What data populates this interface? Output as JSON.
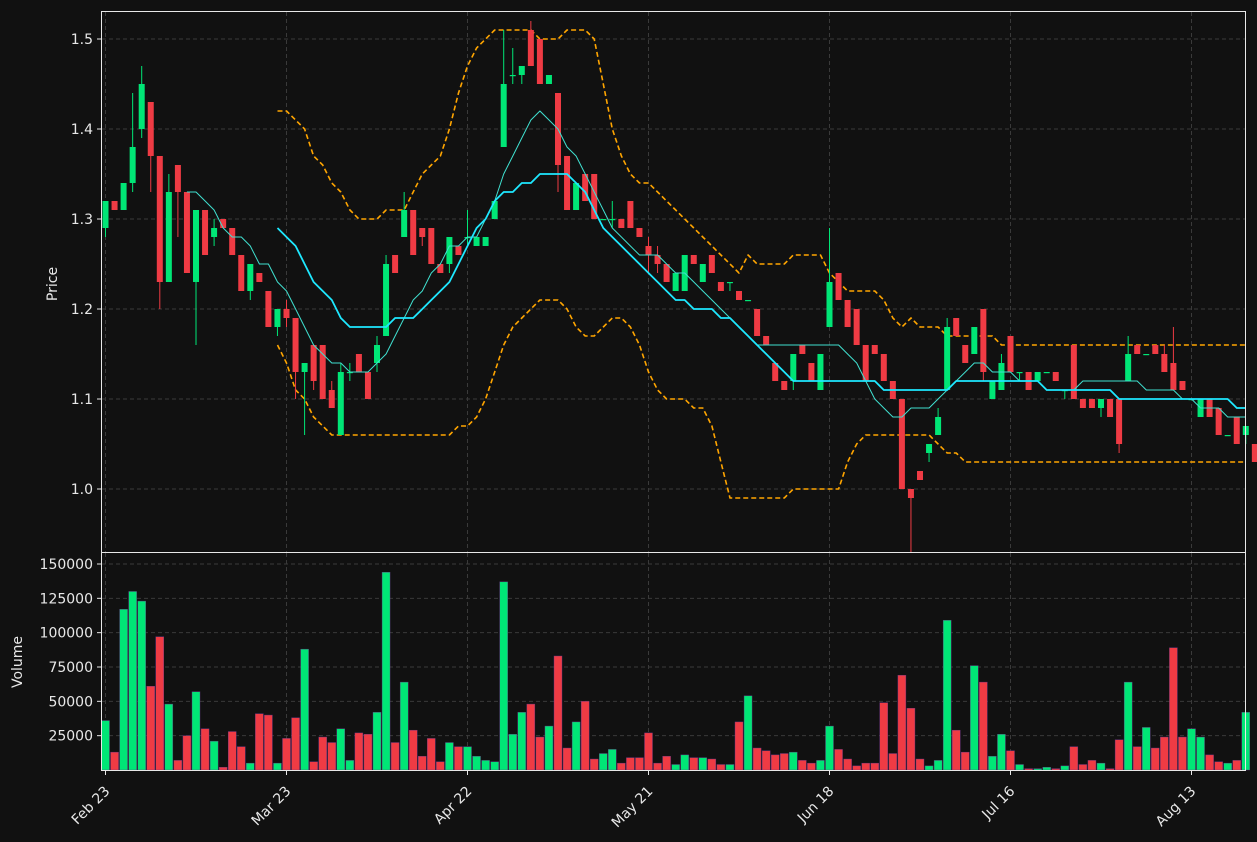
{
  "chart_data": {
    "type": "candlestick",
    "panels": [
      {
        "name": "price",
        "ylabel": "Price",
        "yticks": [
          1.0,
          1.1,
          1.2,
          1.3,
          1.4,
          1.5
        ],
        "ylim": [
          0.93,
          1.53
        ]
      },
      {
        "name": "volume",
        "ylabel": "Volume",
        "yticks": [
          25000,
          50000,
          75000,
          100000,
          125000,
          150000
        ],
        "ylim": [
          0,
          158000
        ]
      }
    ],
    "xticks": [
      {
        "label": "Feb 23",
        "index": 0
      },
      {
        "label": "Mar 23",
        "index": 20
      },
      {
        "label": "Apr 22",
        "index": 40
      },
      {
        "label": "May 21",
        "index": 60
      },
      {
        "label": "Jun 18",
        "index": 80
      },
      {
        "label": "Jul 16",
        "index": 100
      },
      {
        "label": "Aug 13",
        "index": 120
      }
    ],
    "up_color": "#00e676",
    "down_color": "#ef3b44",
    "colors": {
      "ma_fast": "#40e0d0",
      "ma_slow": "#1ee8ff",
      "bands": "#ffa500",
      "grid": "#3a3a3a"
    },
    "ohlc": [
      [
        1.29,
        1.32,
        1.28,
        1.32
      ],
      [
        1.32,
        1.32,
        1.31,
        1.31
      ],
      [
        1.31,
        1.34,
        1.31,
        1.34
      ],
      [
        1.34,
        1.44,
        1.33,
        1.38
      ],
      [
        1.4,
        1.47,
        1.39,
        1.45
      ],
      [
        1.43,
        1.43,
        1.33,
        1.37
      ],
      [
        1.37,
        1.37,
        1.2,
        1.23
      ],
      [
        1.23,
        1.35,
        1.23,
        1.33
      ],
      [
        1.36,
        1.36,
        1.28,
        1.33
      ],
      [
        1.33,
        1.33,
        1.24,
        1.24
      ],
      [
        1.23,
        1.31,
        1.16,
        1.31
      ],
      [
        1.31,
        1.31,
        1.26,
        1.26
      ],
      [
        1.28,
        1.3,
        1.27,
        1.29
      ],
      [
        1.3,
        1.3,
        1.29,
        1.29
      ],
      [
        1.29,
        1.29,
        1.26,
        1.26
      ],
      [
        1.26,
        1.26,
        1.22,
        1.22
      ],
      [
        1.22,
        1.25,
        1.21,
        1.25
      ],
      [
        1.24,
        1.24,
        1.23,
        1.23
      ],
      [
        1.22,
        1.22,
        1.18,
        1.18
      ],
      [
        1.18,
        1.2,
        1.17,
        1.2
      ],
      [
        1.2,
        1.21,
        1.18,
        1.19
      ],
      [
        1.19,
        1.19,
        1.1,
        1.13
      ],
      [
        1.13,
        1.14,
        1.06,
        1.14
      ],
      [
        1.16,
        1.16,
        1.11,
        1.12
      ],
      [
        1.16,
        1.16,
        1.1,
        1.1
      ],
      [
        1.11,
        1.12,
        1.09,
        1.09
      ],
      [
        1.06,
        1.14,
        1.06,
        1.13
      ],
      [
        1.13,
        1.14,
        1.12,
        1.13
      ],
      [
        1.15,
        1.15,
        1.13,
        1.13
      ],
      [
        1.13,
        1.13,
        1.1,
        1.1
      ],
      [
        1.14,
        1.17,
        1.13,
        1.16
      ],
      [
        1.17,
        1.26,
        1.17,
        1.25
      ],
      [
        1.26,
        1.26,
        1.24,
        1.24
      ],
      [
        1.28,
        1.33,
        1.28,
        1.31
      ],
      [
        1.31,
        1.31,
        1.26,
        1.26
      ],
      [
        1.29,
        1.29,
        1.27,
        1.28
      ],
      [
        1.29,
        1.29,
        1.25,
        1.25
      ],
      [
        1.25,
        1.25,
        1.24,
        1.24
      ],
      [
        1.25,
        1.28,
        1.24,
        1.28
      ],
      [
        1.27,
        1.27,
        1.26,
        1.26
      ],
      [
        1.28,
        1.31,
        1.27,
        1.28
      ],
      [
        1.27,
        1.28,
        1.27,
        1.28
      ],
      [
        1.27,
        1.28,
        1.27,
        1.28
      ],
      [
        1.3,
        1.32,
        1.3,
        1.32
      ],
      [
        1.38,
        1.51,
        1.38,
        1.45
      ],
      [
        1.46,
        1.49,
        1.45,
        1.46
      ],
      [
        1.46,
        1.47,
        1.45,
        1.47
      ],
      [
        1.51,
        1.52,
        1.47,
        1.47
      ],
      [
        1.5,
        1.5,
        1.45,
        1.45
      ],
      [
        1.45,
        1.46,
        1.45,
        1.46
      ],
      [
        1.44,
        1.44,
        1.33,
        1.36
      ],
      [
        1.37,
        1.37,
        1.31,
        1.31
      ],
      [
        1.31,
        1.34,
        1.31,
        1.34
      ],
      [
        1.35,
        1.35,
        1.32,
        1.32
      ],
      [
        1.35,
        1.35,
        1.3,
        1.3
      ],
      [
        1.3,
        1.3,
        1.3,
        1.3
      ],
      [
        1.3,
        1.32,
        1.29,
        1.3
      ],
      [
        1.3,
        1.3,
        1.29,
        1.29
      ],
      [
        1.32,
        1.32,
        1.29,
        1.29
      ],
      [
        1.29,
        1.29,
        1.28,
        1.28
      ],
      [
        1.27,
        1.28,
        1.24,
        1.26
      ],
      [
        1.26,
        1.27,
        1.24,
        1.25
      ],
      [
        1.25,
        1.25,
        1.23,
        1.23
      ],
      [
        1.22,
        1.24,
        1.22,
        1.24
      ],
      [
        1.22,
        1.25,
        1.22,
        1.26
      ],
      [
        1.26,
        1.26,
        1.25,
        1.25
      ],
      [
        1.23,
        1.25,
        1.23,
        1.25
      ],
      [
        1.26,
        1.26,
        1.25,
        1.24
      ],
      [
        1.23,
        1.23,
        1.22,
        1.22
      ],
      [
        1.23,
        1.23,
        1.22,
        1.23
      ],
      [
        1.22,
        1.22,
        1.21,
        1.21
      ],
      [
        1.21,
        1.21,
        1.21,
        1.21
      ],
      [
        1.2,
        1.2,
        1.17,
        1.17
      ],
      [
        1.17,
        1.17,
        1.16,
        1.16
      ],
      [
        1.14,
        1.14,
        1.13,
        1.12
      ],
      [
        1.12,
        1.12,
        1.11,
        1.11
      ],
      [
        1.12,
        1.15,
        1.11,
        1.15
      ],
      [
        1.16,
        1.16,
        1.15,
        1.15
      ],
      [
        1.14,
        1.14,
        1.12,
        1.12
      ],
      [
        1.11,
        1.15,
        1.11,
        1.15
      ],
      [
        1.18,
        1.29,
        1.18,
        1.23
      ],
      [
        1.24,
        1.24,
        1.21,
        1.21
      ],
      [
        1.21,
        1.21,
        1.18,
        1.18
      ],
      [
        1.2,
        1.2,
        1.16,
        1.16
      ],
      [
        1.16,
        1.16,
        1.12,
        1.12
      ],
      [
        1.16,
        1.16,
        1.15,
        1.15
      ],
      [
        1.15,
        1.15,
        1.12,
        1.12
      ],
      [
        1.12,
        1.12,
        1.1,
        1.1
      ],
      [
        1.1,
        1.1,
        1.01,
        1.0
      ],
      [
        1.0,
        1.0,
        0.93,
        0.99
      ],
      [
        1.02,
        1.02,
        1.01,
        1.01
      ],
      [
        1.04,
        1.05,
        1.03,
        1.05
      ],
      [
        1.06,
        1.09,
        1.06,
        1.08
      ],
      [
        1.11,
        1.19,
        1.11,
        1.18
      ],
      [
        1.19,
        1.19,
        1.17,
        1.17
      ],
      [
        1.16,
        1.16,
        1.14,
        1.14
      ],
      [
        1.15,
        1.18,
        1.15,
        1.18
      ],
      [
        1.2,
        1.2,
        1.12,
        1.13
      ],
      [
        1.1,
        1.12,
        1.1,
        1.12
      ],
      [
        1.11,
        1.15,
        1.11,
        1.14
      ],
      [
        1.17,
        1.17,
        1.13,
        1.13
      ],
      [
        1.13,
        1.13,
        1.12,
        1.13
      ],
      [
        1.13,
        1.13,
        1.11,
        1.11
      ],
      [
        1.12,
        1.13,
        1.12,
        1.13
      ],
      [
        1.13,
        1.13,
        1.13,
        1.13
      ],
      [
        1.13,
        1.13,
        1.12,
        1.12
      ],
      [
        1.11,
        1.11,
        1.1,
        1.11
      ],
      [
        1.16,
        1.16,
        1.1,
        1.1
      ],
      [
        1.1,
        1.1,
        1.09,
        1.09
      ],
      [
        1.1,
        1.1,
        1.09,
        1.09
      ],
      [
        1.09,
        1.1,
        1.08,
        1.1
      ],
      [
        1.1,
        1.1,
        1.08,
        1.08
      ],
      [
        1.1,
        1.1,
        1.04,
        1.05
      ],
      [
        1.12,
        1.17,
        1.12,
        1.15
      ],
      [
        1.16,
        1.16,
        1.15,
        1.15
      ],
      [
        1.15,
        1.15,
        1.15,
        1.15
      ],
      [
        1.16,
        1.16,
        1.15,
        1.15
      ],
      [
        1.15,
        1.16,
        1.13,
        1.13
      ],
      [
        1.14,
        1.18,
        1.11,
        1.11
      ],
      [
        1.12,
        1.12,
        1.11,
        1.11
      ],
      [
        1.1,
        1.1,
        1.1,
        1.1
      ],
      [
        1.08,
        1.1,
        1.08,
        1.1
      ],
      [
        1.1,
        1.1,
        1.08,
        1.08
      ],
      [
        1.09,
        1.09,
        1.06,
        1.06
      ],
      [
        1.06,
        1.06,
        1.06,
        1.06
      ],
      [
        1.08,
        1.08,
        1.05,
        1.05
      ],
      [
        1.06,
        1.07,
        1.05,
        1.07
      ],
      [
        1.05,
        1.05,
        1.03,
        1.03
      ]
    ],
    "volume": [
      36000,
      13000,
      117000,
      130000,
      123000,
      61000,
      97000,
      48000,
      7000,
      25000,
      57000,
      30000,
      21000,
      2000,
      28000,
      17000,
      5000,
      41000,
      40000,
      5000,
      23000,
      38000,
      88000,
      6000,
      24000,
      20000,
      30000,
      7000,
      27000,
      26000,
      42000,
      144000,
      20000,
      64000,
      29000,
      10000,
      23000,
      6000,
      20000,
      17000,
      17000,
      10000,
      7000,
      6000,
      137000,
      26000,
      42000,
      48000,
      24000,
      32000,
      83000,
      16000,
      35000,
      50000,
      8000,
      12000,
      15000,
      5000,
      9000,
      9000,
      27000,
      5000,
      10000,
      4000,
      11000,
      9000,
      9000,
      8000,
      4000,
      4000,
      35000,
      54000,
      16000,
      14000,
      11000,
      12000,
      13000,
      7000,
      5000,
      7000,
      32000,
      15000,
      8000,
      3000,
      5000,
      5000,
      49000,
      12000,
      69000,
      45000,
      8000,
      3000,
      7000,
      109000,
      29000,
      13000,
      76000,
      64000,
      10000,
      26000,
      14000,
      4000,
      1000,
      1000,
      2000,
      1000,
      3000,
      17000,
      4000,
      7000,
      5000,
      1000,
      22000,
      64000,
      17000,
      31000,
      16000,
      24000,
      89000,
      24000,
      30000,
      24000,
      11000,
      6000,
      5000,
      7000,
      42000
    ],
    "ma_fast": [
      null,
      null,
      null,
      null,
      null,
      null,
      null,
      null,
      null,
      1.33,
      1.33,
      1.32,
      1.31,
      1.29,
      1.28,
      1.28,
      1.27,
      1.25,
      1.25,
      1.23,
      1.22,
      1.2,
      1.18,
      1.16,
      1.15,
      1.14,
      1.14,
      1.13,
      1.13,
      1.13,
      1.14,
      1.15,
      1.17,
      1.19,
      1.21,
      1.22,
      1.24,
      1.25,
      1.27,
      1.27,
      1.28,
      1.28,
      1.3,
      1.32,
      1.35,
      1.37,
      1.39,
      1.41,
      1.42,
      1.41,
      1.4,
      1.38,
      1.37,
      1.35,
      1.33,
      1.31,
      1.29,
      1.28,
      1.27,
      1.26,
      1.26,
      1.26,
      1.25,
      1.24,
      1.24,
      1.23,
      1.22,
      1.21,
      1.2,
      1.19,
      1.18,
      1.17,
      1.16,
      1.16,
      1.16,
      1.16,
      1.16,
      1.16,
      1.16,
      1.16,
      1.16,
      1.16,
      1.15,
      1.14,
      1.12,
      1.1,
      1.09,
      1.08,
      1.08,
      1.09,
      1.09,
      1.09,
      1.1,
      1.11,
      1.12,
      1.13,
      1.14,
      1.14,
      1.13,
      1.13,
      1.13,
      1.12,
      1.12,
      1.12,
      1.11,
      1.11,
      1.11,
      1.11,
      1.12,
      1.12,
      1.12,
      1.12,
      1.12,
      1.12,
      1.12,
      1.11,
      1.11,
      1.11,
      1.11,
      1.1,
      1.1,
      1.09,
      1.09,
      1.09,
      1.08,
      1.08,
      1.08
    ],
    "ma_slow": [
      null,
      null,
      null,
      null,
      null,
      null,
      null,
      null,
      null,
      null,
      null,
      null,
      null,
      null,
      null,
      null,
      null,
      null,
      null,
      1.29,
      1.28,
      1.27,
      1.25,
      1.23,
      1.22,
      1.21,
      1.19,
      1.18,
      1.18,
      1.18,
      1.18,
      1.18,
      1.19,
      1.19,
      1.19,
      1.2,
      1.21,
      1.22,
      1.23,
      1.25,
      1.27,
      1.29,
      1.3,
      1.32,
      1.33,
      1.33,
      1.34,
      1.34,
      1.35,
      1.35,
      1.35,
      1.35,
      1.34,
      1.33,
      1.31,
      1.29,
      1.28,
      1.27,
      1.26,
      1.25,
      1.24,
      1.23,
      1.22,
      1.21,
      1.21,
      1.2,
      1.2,
      1.2,
      1.19,
      1.19,
      1.18,
      1.17,
      1.16,
      1.15,
      1.14,
      1.13,
      1.12,
      1.12,
      1.12,
      1.12,
      1.12,
      1.12,
      1.12,
      1.12,
      1.12,
      1.12,
      1.11,
      1.11,
      1.11,
      1.11,
      1.11,
      1.11,
      1.11,
      1.11,
      1.12,
      1.12,
      1.12,
      1.12,
      1.12,
      1.12,
      1.12,
      1.12,
      1.12,
      1.12,
      1.11,
      1.11,
      1.11,
      1.11,
      1.11,
      1.11,
      1.11,
      1.11,
      1.1,
      1.1,
      1.1,
      1.1,
      1.1,
      1.1,
      1.1,
      1.1,
      1.1,
      1.1,
      1.1,
      1.1,
      1.1,
      1.09,
      1.09
    ],
    "band_upper": [
      null,
      null,
      null,
      null,
      null,
      null,
      null,
      null,
      null,
      null,
      null,
      null,
      null,
      null,
      null,
      null,
      null,
      null,
      null,
      1.42,
      1.42,
      1.41,
      1.4,
      1.37,
      1.36,
      1.34,
      1.33,
      1.31,
      1.3,
      1.3,
      1.3,
      1.31,
      1.31,
      1.31,
      1.33,
      1.35,
      1.36,
      1.37,
      1.4,
      1.44,
      1.47,
      1.49,
      1.5,
      1.51,
      1.51,
      1.51,
      1.51,
      1.51,
      1.5,
      1.5,
      1.5,
      1.51,
      1.51,
      1.51,
      1.5,
      1.45,
      1.4,
      1.37,
      1.35,
      1.34,
      1.34,
      1.33,
      1.32,
      1.31,
      1.3,
      1.29,
      1.28,
      1.27,
      1.26,
      1.25,
      1.24,
      1.26,
      1.25,
      1.25,
      1.25,
      1.25,
      1.26,
      1.26,
      1.26,
      1.26,
      1.24,
      1.23,
      1.22,
      1.22,
      1.22,
      1.22,
      1.21,
      1.19,
      1.18,
      1.19,
      1.18,
      1.18,
      1.18,
      1.17,
      1.17,
      1.17,
      1.17,
      1.17,
      1.17,
      1.16,
      1.16,
      1.16,
      1.16,
      1.16,
      1.16,
      1.16,
      1.16,
      1.16,
      1.16,
      1.16,
      1.16,
      1.16,
      1.16,
      1.16,
      1.16,
      1.16,
      1.16,
      1.16,
      1.16,
      1.16,
      1.16,
      1.16,
      1.16,
      1.16,
      1.16,
      1.16,
      1.16
    ],
    "band_lower": [
      null,
      null,
      null,
      null,
      null,
      null,
      null,
      null,
      null,
      null,
      null,
      null,
      null,
      null,
      null,
      null,
      null,
      null,
      null,
      1.16,
      1.14,
      1.11,
      1.1,
      1.08,
      1.07,
      1.06,
      1.06,
      1.06,
      1.06,
      1.06,
      1.06,
      1.06,
      1.06,
      1.06,
      1.06,
      1.06,
      1.06,
      1.06,
      1.06,
      1.07,
      1.07,
      1.08,
      1.1,
      1.13,
      1.16,
      1.18,
      1.19,
      1.2,
      1.21,
      1.21,
      1.21,
      1.2,
      1.18,
      1.17,
      1.17,
      1.18,
      1.19,
      1.19,
      1.18,
      1.16,
      1.13,
      1.11,
      1.1,
      1.1,
      1.1,
      1.09,
      1.09,
      1.07,
      1.03,
      0.99,
      0.99,
      0.99,
      0.99,
      0.99,
      0.99,
      0.99,
      1.0,
      1.0,
      1.0,
      1.0,
      1.0,
      1.0,
      1.03,
      1.05,
      1.06,
      1.06,
      1.06,
      1.06,
      1.06,
      1.06,
      1.06,
      1.06,
      1.05,
      1.04,
      1.04,
      1.03,
      1.03,
      1.03,
      1.03,
      1.03,
      1.03,
      1.03,
      1.03,
      1.03,
      1.03,
      1.03,
      1.03,
      1.03,
      1.03,
      1.03,
      1.03,
      1.03,
      1.03,
      1.03,
      1.03,
      1.03,
      1.03,
      1.03,
      1.03,
      1.03,
      1.03,
      1.03,
      1.03,
      1.03,
      1.03,
      1.03,
      1.03
    ]
  }
}
